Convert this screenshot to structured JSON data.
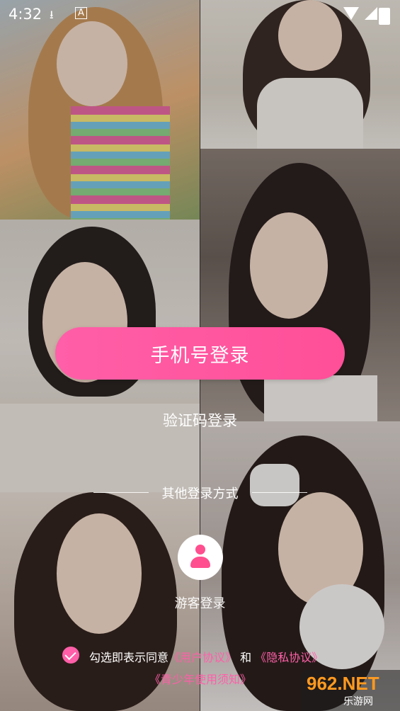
{
  "status_bar": {
    "time": "4:32"
  },
  "login": {
    "phone_button": "手机号登录",
    "sms_login": "验证码登录",
    "other_methods": "其他登录方式",
    "guest_label": "游客登录"
  },
  "agreement": {
    "checked": true,
    "prefix": "勾选即表示同意",
    "user_agreement": "《用户协议》",
    "and": "和",
    "privacy": "《隐私协议》",
    "youth": "《青少年使用须知》"
  },
  "watermark": {
    "logo": "962.NET",
    "sub": "乐游网"
  },
  "colors": {
    "accent": "#ff5fa8",
    "guest_icon": "#ff4f8e"
  },
  "icons": [
    "download-icon",
    "a-icon",
    "wifi-icon",
    "signal-icon",
    "battery-icon",
    "user-icon",
    "check-icon"
  ]
}
